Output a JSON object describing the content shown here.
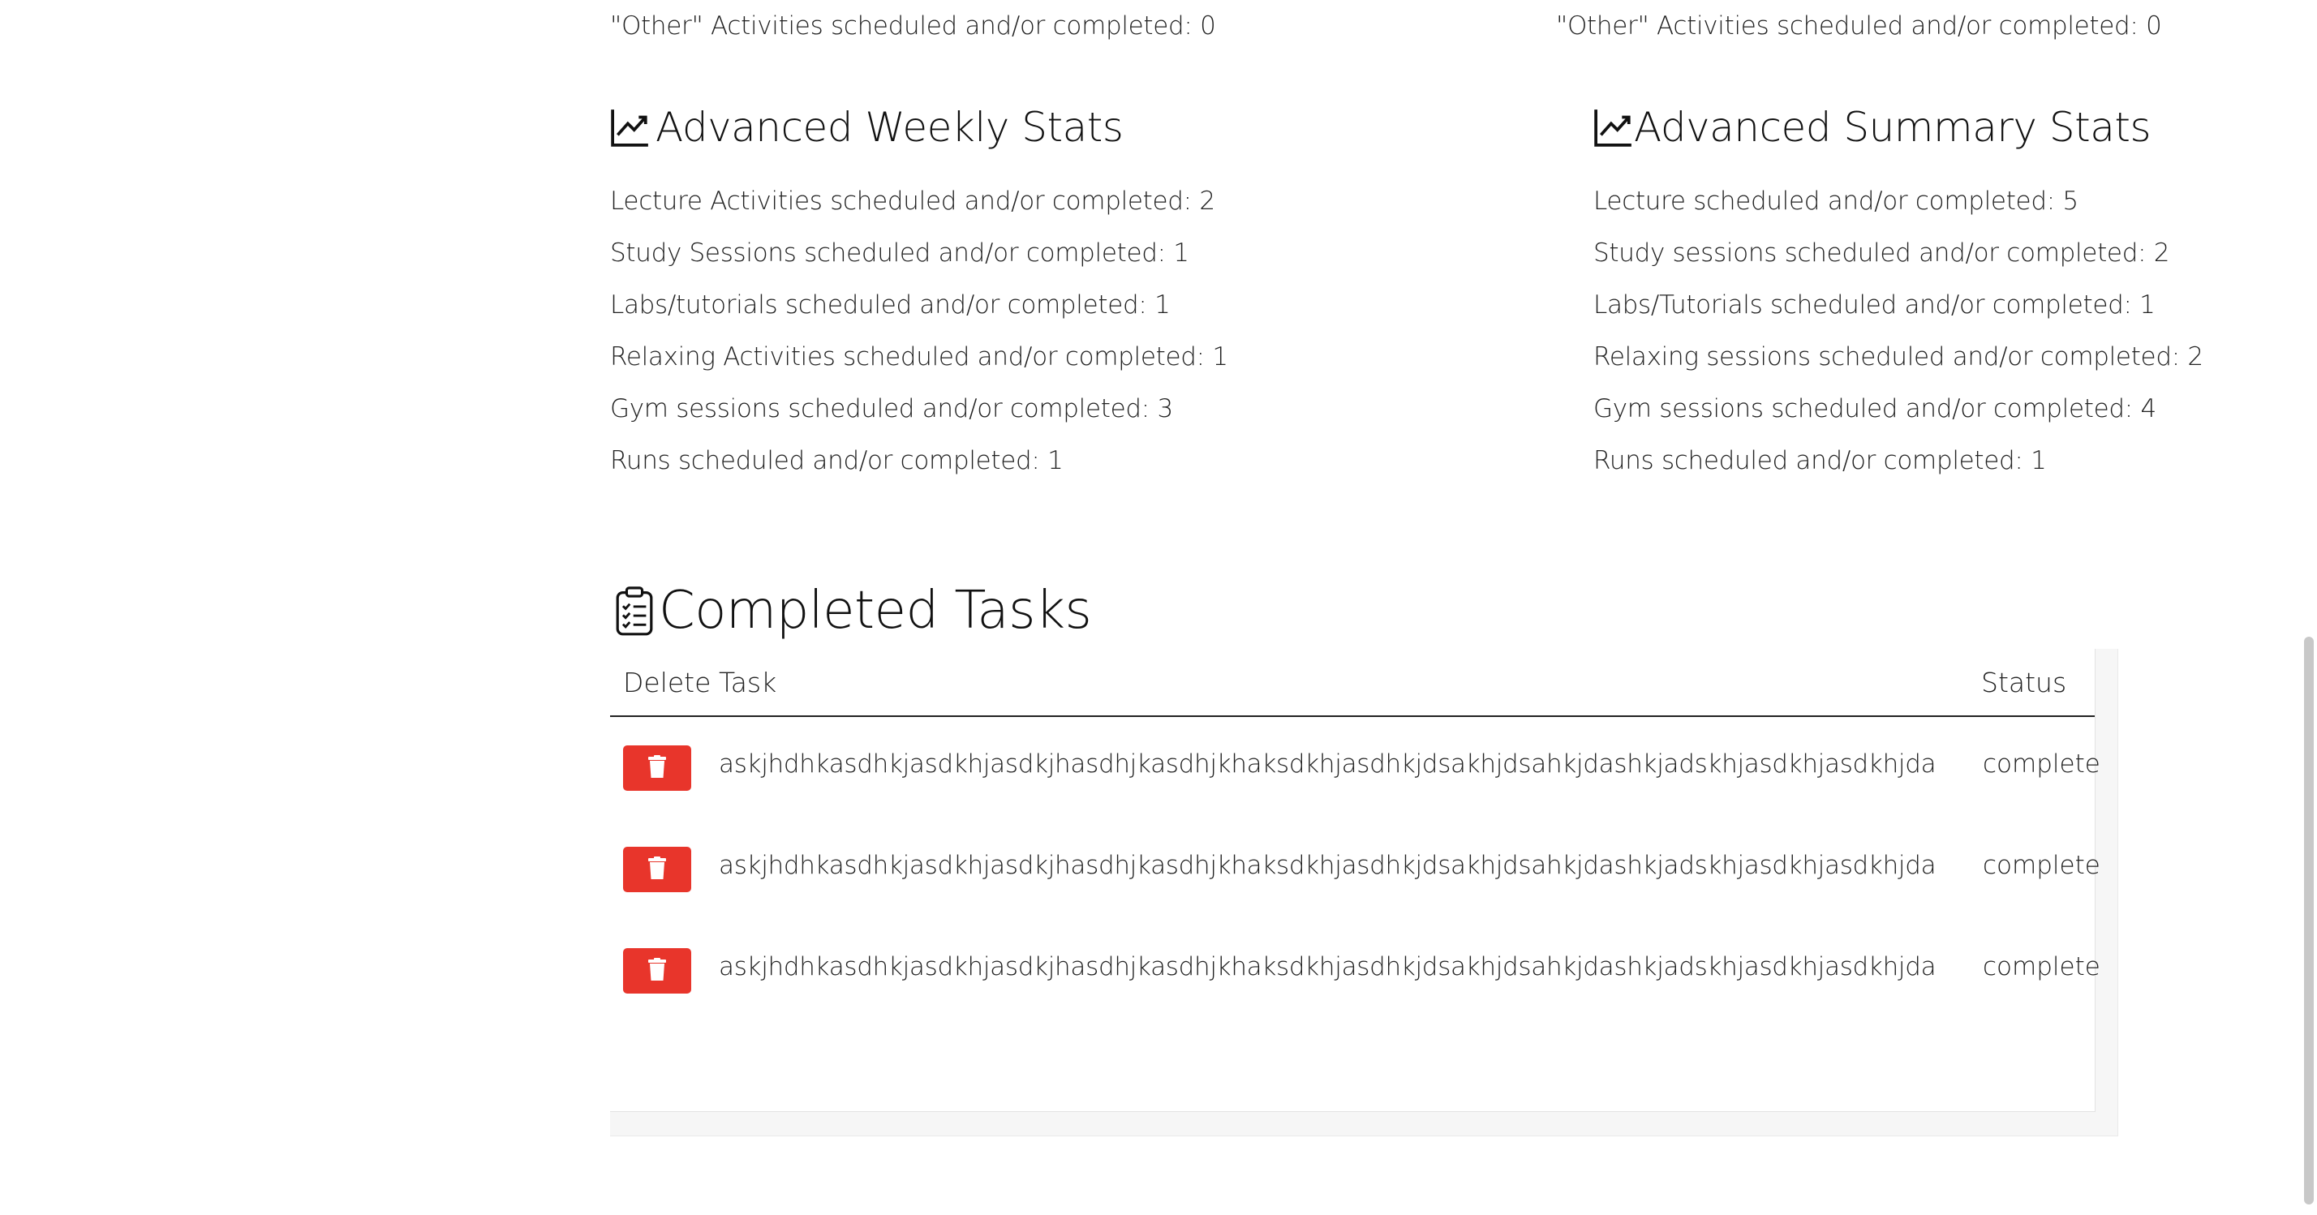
{
  "weekly": {
    "other_line": "\"Other\" Activities scheduled and/or completed: 0",
    "heading": "Advanced Weekly Stats",
    "icon": "line-chart-icon",
    "stats": [
      "Lecture Activities scheduled and/or completed: 2",
      "Study Sessions scheduled and/or completed: 1",
      "Labs/tutorials scheduled and/or completed: 1",
      "Relaxing Activities scheduled and/or completed: 1",
      "Gym sessions scheduled and/or completed: 3",
      "Runs scheduled and/or completed: 1"
    ]
  },
  "summary": {
    "other_line": "\"Other\" Activities scheduled and/or completed: 0",
    "heading": "Advanced Summary Stats",
    "icon": "line-chart-icon",
    "stats": [
      "Lecture scheduled and/or completed: 5",
      "Study sessions scheduled and/or completed: 2",
      "Labs/Tutorials scheduled and/or completed: 1",
      "Relaxing sessions scheduled and/or completed: 2",
      "Gym sessions scheduled and/or completed: 4",
      "Runs scheduled and/or completed: 1"
    ]
  },
  "completed": {
    "heading": "Completed Tasks",
    "icon": "clipboard-checklist-icon",
    "columns": {
      "delete": "Delete",
      "task": "Task",
      "status": "Status"
    },
    "rows": [
      {
        "task": "askjhdhkasdhkjasdkhjasdkjhasdhjkasdhjkhaksdkhjasdhkjdsakhjdsahkjdashkjadskhjasdkhjasdkhjda",
        "status": "complete"
      },
      {
        "task": "askjhdhkasdhkjasdkhjasdkjhasdhjkasdhjkhaksdkhjasdhkjdsakhjdsahkjdashkjadskhjasdkhjasdkhjda",
        "status": "complete"
      },
      {
        "task": "askjhdhkasdhkjasdkhjasdkjhasdhjkasdhjkhaksdkhjasdhkjdsakhjdsahkjdashkjadskhjasdkhjasdkhjda",
        "status": "complete"
      }
    ]
  },
  "colors": {
    "delete_button": "#e8352b",
    "text": "#222222"
  }
}
